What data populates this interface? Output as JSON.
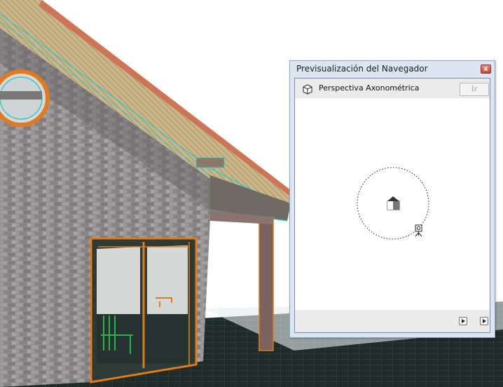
{
  "palette": {
    "title": "Previsualización del Navegador",
    "close_glyph": "x",
    "view_icon": "cube-outline-icon",
    "view_label": "Perspectiva Axonométrica",
    "go_button_label": "Ir",
    "preview_icons": [
      "house-icon",
      "camera-icon"
    ],
    "nav_icons": [
      "play-icon",
      "play-icon"
    ]
  },
  "scene": {
    "description_icons": [
      "window-icon",
      "door-icon",
      "chair-icon",
      "faucet-icon"
    ]
  }
}
